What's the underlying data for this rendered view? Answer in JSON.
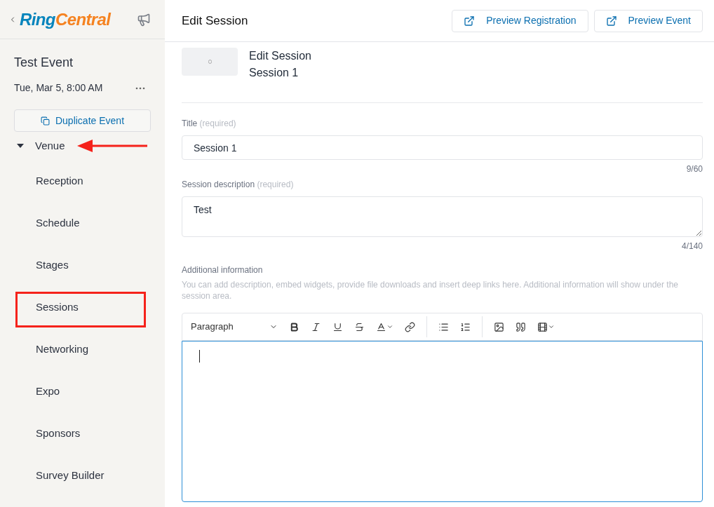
{
  "logo": [
    "Ring",
    "Central"
  ],
  "event": {
    "title": "Test Event",
    "date": "Tue, Mar 5, 8:00 AM",
    "duplicate_button": "Duplicate Event"
  },
  "nav": [
    {
      "label": "Venue",
      "expanded": true,
      "annotated": true,
      "children": [
        {
          "label": "Reception",
          "annotated": false
        },
        {
          "label": "Schedule",
          "annotated": false
        },
        {
          "label": "Stages",
          "annotated": false
        },
        {
          "label": "Sessions",
          "annotated": true
        },
        {
          "label": "Networking",
          "annotated": false
        },
        {
          "label": "Expo",
          "annotated": false
        },
        {
          "label": "Sponsors",
          "annotated": false
        },
        {
          "label": "Survey Builder",
          "annotated": false
        }
      ]
    }
  ],
  "header": {
    "title": "Edit Session",
    "buttons": [
      "Preview Registration",
      "Preview Event"
    ]
  },
  "session": {
    "heading": "Edit Session",
    "name": "Session 1"
  },
  "fields": [
    {
      "kind": "input",
      "label": "Title",
      "note": "(required)",
      "value": "Session 1",
      "counter": "9/60"
    },
    {
      "kind": "textarea",
      "label": "Session description",
      "note": "(required)",
      "value": "Test",
      "counter": "4/140"
    }
  ],
  "additional": {
    "label": "Additional information",
    "help": "You can add description, embed widgets, provide file downloads and insert deep links here. Additional information will show under the session area.",
    "block_style": "Paragraph"
  }
}
